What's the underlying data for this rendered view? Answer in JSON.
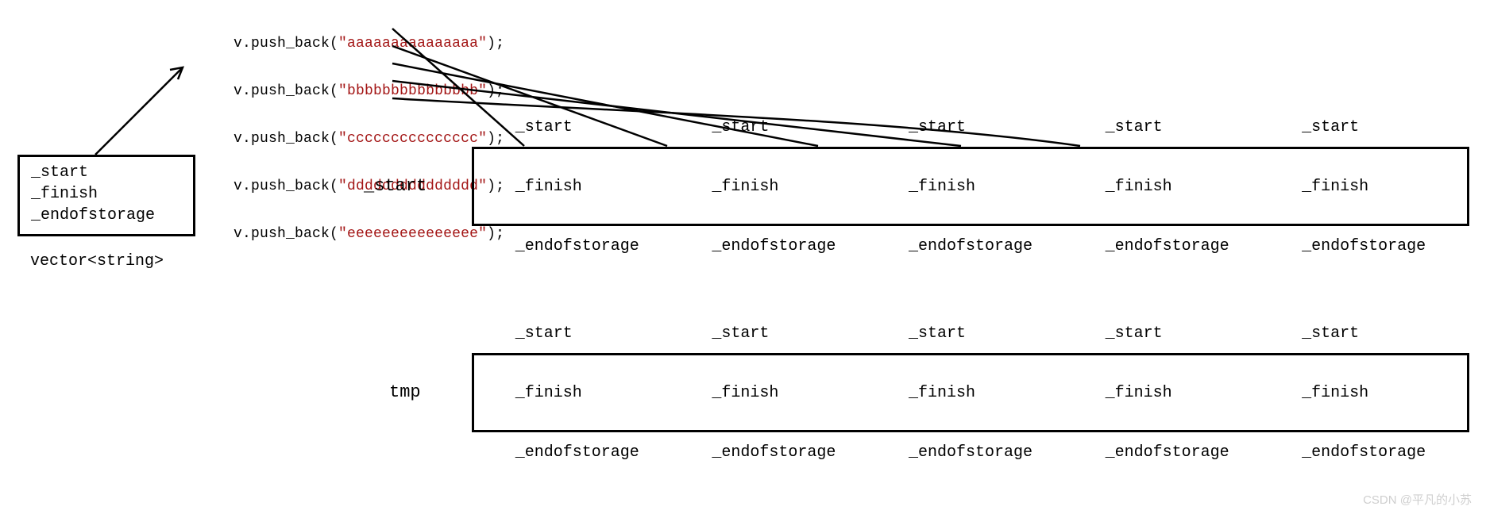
{
  "vector_box": {
    "l1": "_start",
    "l2": "_finish",
    "l3": "_endofstorage",
    "caption": "vector<string>"
  },
  "code_lines": [
    {
      "p": "v.push_back(",
      "q": "\"aaaaaaaaaaaaaaa\"",
      "r": ");"
    },
    {
      "p": "v.push_back(",
      "q": "\"bbbbbbbbbbbbbbb\"",
      "r": ");"
    },
    {
      "p": "v.push_back(",
      "q": "\"ccccccccccccccc\"",
      "r": ");"
    },
    {
      "p": "v.push_back(",
      "q": "\"ddddddddddddddd\"",
      "r": ");"
    },
    {
      "p": "v.push_back(",
      "q": "\"eeeeeeeeeeeeeee\"",
      "r": ");"
    }
  ],
  "row1_label": "_start",
  "row2_label": "tmp",
  "elem": {
    "l1": "_start",
    "l2": "_finish",
    "l3": "_endofstorage"
  },
  "watermark": "CSDN @平凡的小苏"
}
